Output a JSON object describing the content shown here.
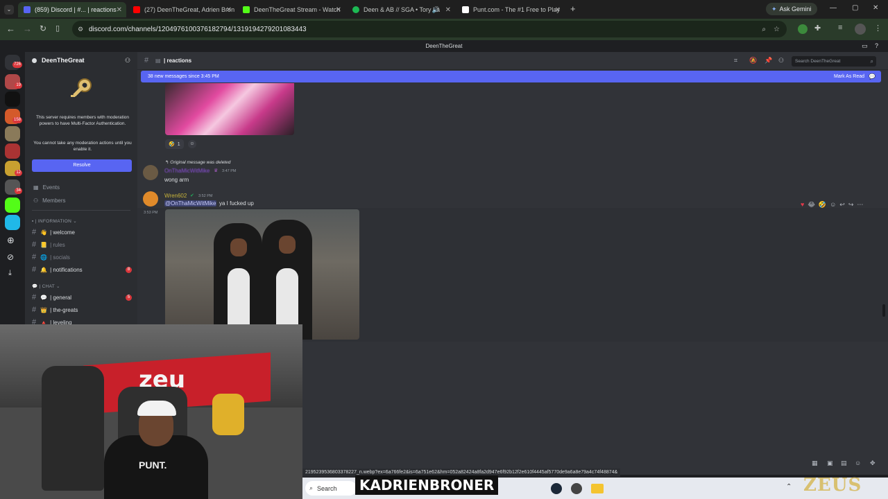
{
  "browser": {
    "tabs": [
      {
        "label": "(859) Discord | #... | reactions",
        "color": "#5865f2",
        "active": true
      },
      {
        "label": "(27) DeenTheGreat, Adrien Bron",
        "color": "#ff0000"
      },
      {
        "label": "DeenTheGreat Stream - Watch",
        "color": "#53fc18"
      },
      {
        "label": "Deen & AB // SGA • Tory La",
        "color": "#1db954"
      },
      {
        "label": "Punt.com - The #1 Free to Play",
        "color": "#ffffff"
      }
    ],
    "ask_gemini": "Ask Gemini",
    "url": "discord.com/channels/1204976100376182794/1319194279201083443"
  },
  "discord": {
    "window_title": "DeenTheGreat",
    "server_name": "DeenTheGreat",
    "mfa_notice": "This server requires members with moderation powers to have Multi-Factor Authentication.",
    "mfa_notice2": "You cannot take any moderation actions until you enable it.",
    "resolve_label": "Resolve",
    "events_label": "Events",
    "members_label": "Members",
    "categories": {
      "info": "| INFORMATION",
      "chat": "| CHAT"
    },
    "channels": [
      {
        "name": "| welcome",
        "muted": false
      },
      {
        "name": "| rules",
        "muted": true
      },
      {
        "name": "| socials",
        "muted": true
      },
      {
        "name": "| notifications",
        "muted": false,
        "badge": "8"
      },
      {
        "name": "| general",
        "muted": false,
        "badge": "5"
      },
      {
        "name": "| the-greats",
        "muted": false
      },
      {
        "name": "| leveling",
        "muted": false
      }
    ],
    "channel_title": "| reactions",
    "search_placeholder": "Search DeenTheGreat",
    "new_messages": "38 new messages since 3:45 PM",
    "mark_as_read": "Mark As Read",
    "reaction_count": "1",
    "deleted_notice": "Original message was deleted",
    "msg1": {
      "user": "OnThaMicWitMike",
      "time": "3:47 PM",
      "text": "wong arm"
    },
    "msg2": {
      "user": "Wren602",
      "time": "3:52 PM",
      "mention": "@OnThaMicWitMike",
      "text": "ya I fucked up",
      "side_time": "3:53 PM"
    },
    "server_badges": [
      "726",
      "19",
      "158",
      "12",
      "34"
    ]
  },
  "status_url": "2195239536803378227_n.webp?ex=6a766fe2&is=6a751e62&hm=052a82424a8fa2d947e6f92b12f2e610f4445af5770de9a6a8e79a4c74f48874&",
  "taskbar": {
    "search_label": "Search"
  },
  "overlay": {
    "banner": "KADRIENBRONER",
    "logo": "ZEUS"
  }
}
